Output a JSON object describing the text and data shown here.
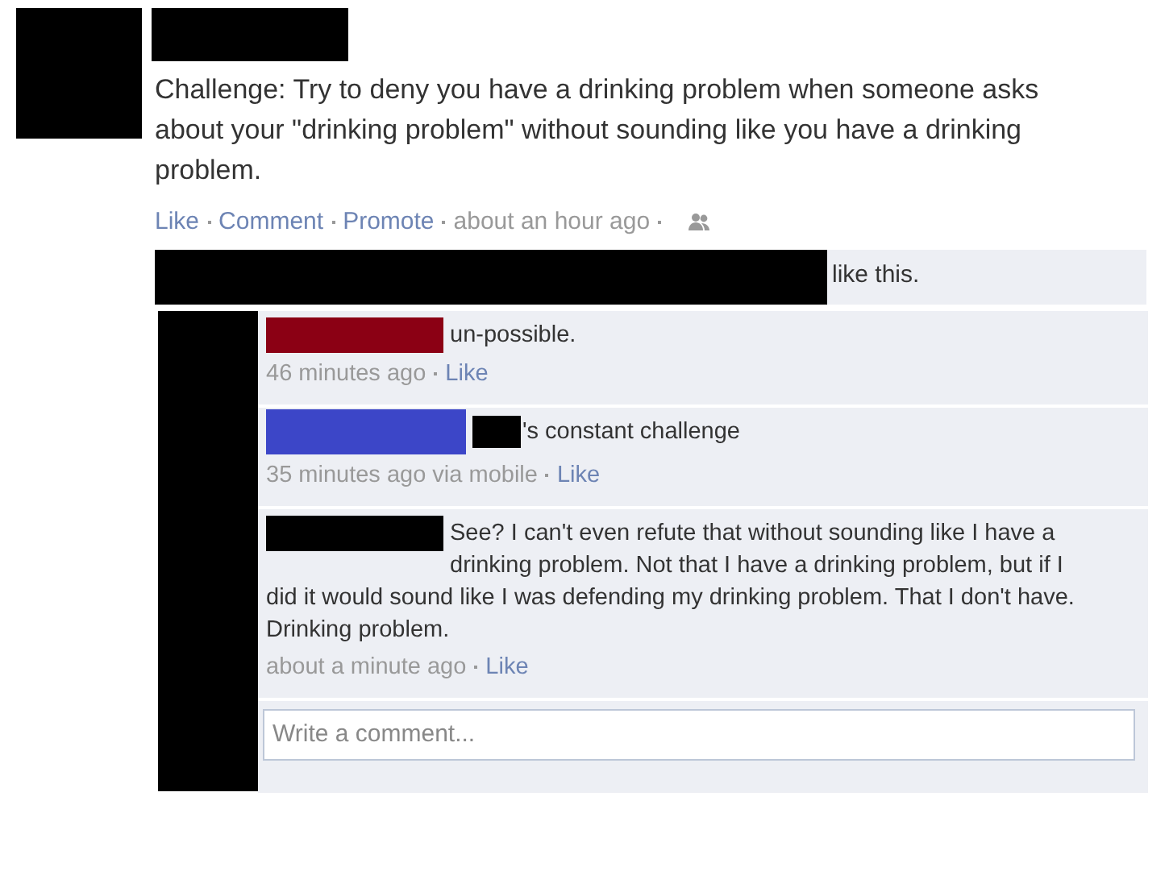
{
  "post": {
    "text": "Challenge: Try to deny you have a drinking problem when someone asks about your \"drinking problem\" without sounding like you have a drinking problem.",
    "actions": [
      "Like",
      "Comment",
      "Promote"
    ],
    "time": "about an hour ago"
  },
  "likes": {
    "text": "like this."
  },
  "comments": [
    {
      "color": "#8b0014",
      "mention_redacted": false,
      "text": "un-possible.",
      "time": "46 minutes ago",
      "like": "Like"
    },
    {
      "color": "#3c46c8",
      "mention_redacted": true,
      "text": "'s constant challenge",
      "time": "35 minutes ago via mobile",
      "like": "Like"
    },
    {
      "color": "#000000",
      "mention_redacted": false,
      "text": "See? I can't even refute that without sounding like I have a drinking problem. Not that I have a drinking problem, but if I did it would sound like I was defending my drinking problem. That I don't have. Drinking problem.",
      "time": "about a minute ago",
      "like": "Like"
    }
  ],
  "comment_box": {
    "placeholder": "Write a comment..."
  }
}
